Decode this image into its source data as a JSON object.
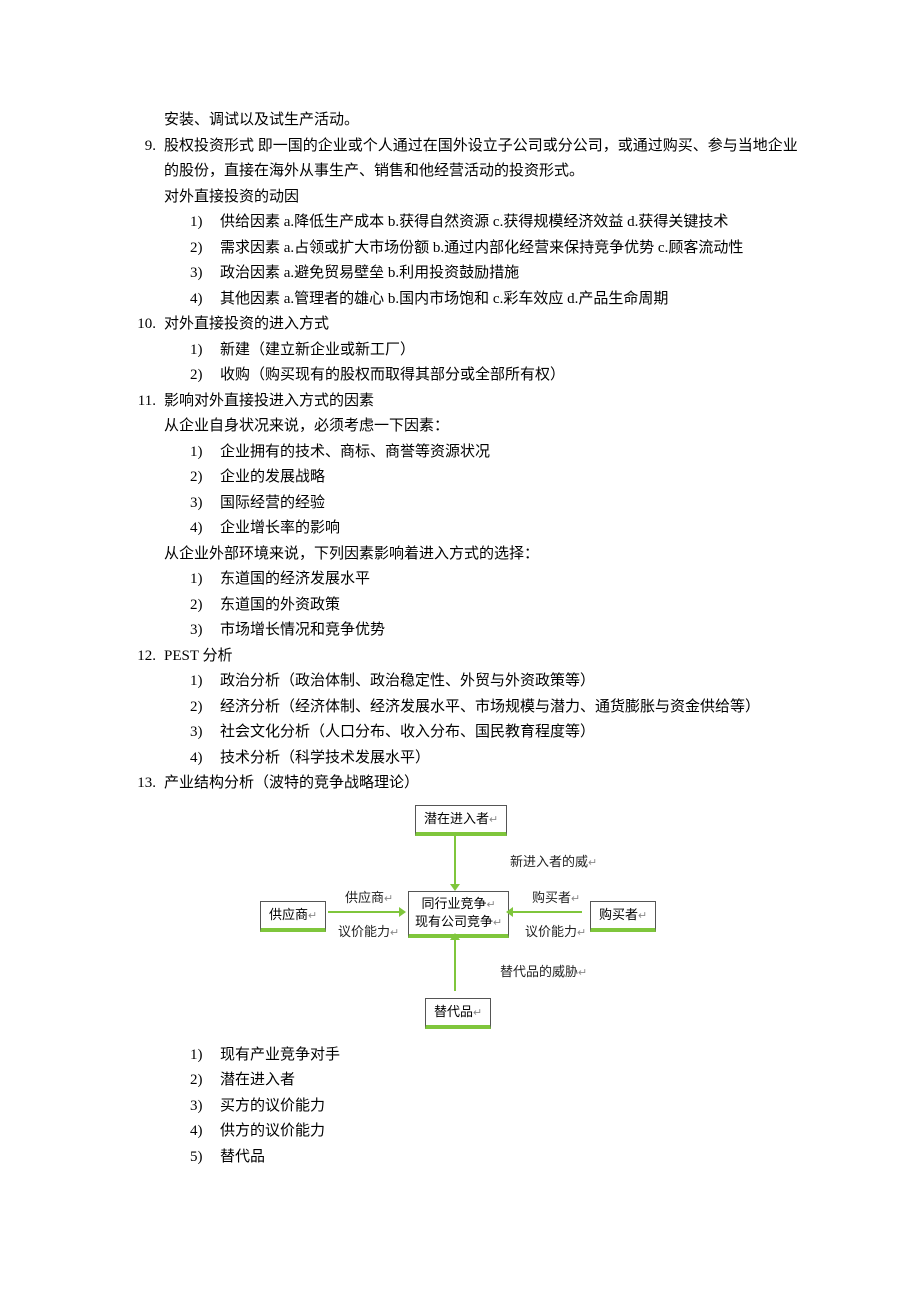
{
  "lines": {
    "cont8": "安装、调试以及试生产活动。",
    "item9_body": "股权投资形式 即一国的企业或个人通过在国外设立子公司或分公司，或通过购买、参与当地企业的股份，直接在海外从事生产、销售和他经营活动的投资形式。",
    "item9_extra": "对外直接投资的动因",
    "i9s1": "供给因素 a.降低生产成本 b.获得自然资源 c.获得规模经济效益 d.获得关键技术",
    "i9s2": "需求因素 a.占领或扩大市场份额 b.通过内部化经营来保持竞争优势 c.顾客流动性",
    "i9s3": "政治因素 a.避免贸易壁垒 b.利用投资鼓励措施",
    "i9s4": "其他因素 a.管理者的雄心 b.国内市场饱和 c.彩车效应 d.产品生命周期",
    "item10": "对外直接投资的进入方式",
    "i10s1": "新建（建立新企业或新工厂）",
    "i10s2": "收购（购买现有的股权而取得其部分或全部所有权）",
    "item11": "影响对外直接投进入方式的因素",
    "i11l1": "从企业自身状况来说，必须考虑一下因素：",
    "i11a1": "企业拥有的技术、商标、商誉等资源状况",
    "i11a2": "企业的发展战略",
    "i11a3": "国际经营的经验",
    "i11a4": "企业增长率的影响",
    "i11l2": "从企业外部环境来说，下列因素影响着进入方式的选择：",
    "i11b1": "东道国的经济发展水平",
    "i11b2": "东道国的外资政策",
    "i11b3": "市场增长情况和竞争优势",
    "item12": "PEST 分析",
    "i12s1": "政治分析（政治体制、政治稳定性、外贸与外资政策等）",
    "i12s2": "经济分析（经济体制、经济发展水平、市场规模与潜力、通货膨胀与资金供给等）",
    "i12s3": "社会文化分析（人口分布、收入分布、国民教育程度等）",
    "i12s4": "技术分析（科学技术发展水平）",
    "item13": "产业结构分析（波特的竞争战略理论）",
    "i13s1": "现有产业竞争对手",
    "i13s2": "潜在进入者",
    "i13s3": "买方的议价能力",
    "i13s4": "供方的议价能力",
    "i13s5": "替代品"
  },
  "diagram": {
    "top": "潜在进入者",
    "left": "供应商",
    "center1": "同行业竞争",
    "center2": "现有公司竞争",
    "right": "购买者",
    "bottom": "替代品",
    "lbl_top": "新进入者的威",
    "lbl_left1": "供应商",
    "lbl_left2": "议价能力",
    "lbl_right1": "购买者",
    "lbl_right2": "议价能力",
    "lbl_bottom": "替代品的威胁"
  },
  "numbers": {
    "n9": "9.",
    "n10": "10.",
    "n11": "11.",
    "n12": "12.",
    "n13": "13.",
    "s1": "1)",
    "s2": "2)",
    "s3": "3)",
    "s4": "4)",
    "s5": "5)"
  }
}
